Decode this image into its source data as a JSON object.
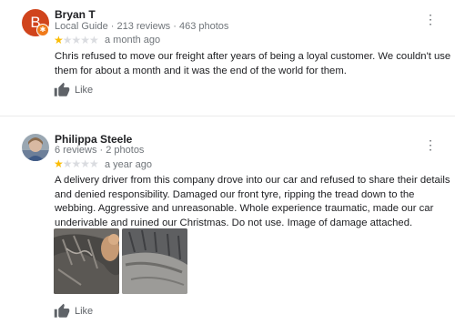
{
  "reviews": [
    {
      "avatar_letter": "B",
      "name": "Bryan T",
      "meta": "Local Guide · 213 reviews · 463 photos",
      "rating": 1,
      "time": "a month ago",
      "text": "Chris refused to move our freight after years of being a loyal customer. We couldn't use them for about a month and it was the end of the world for them.",
      "like_label": "Like",
      "more_icon": "more-vert-icon"
    },
    {
      "name": "Philippa Steele",
      "meta": "6 reviews · 2 photos",
      "rating": 1,
      "time": "a year ago",
      "text": "A delivery driver from this company drove into our car and refused to share their details and denied responsibility. Damaged our front tyre, ripping the tread down to the webbing. Aggressive and unreasonable. Whole experience traumatic, made our car underivable and ruined our Christmas. Do not use. Image of damage attached.",
      "like_label": "Like",
      "more_icon": "more-vert-icon",
      "photos": [
        "tyre-damage-photo",
        "tyre-tread-photo"
      ]
    }
  ],
  "colors": {
    "avatar_bg": "#d0441c",
    "local_guide_badge": "#f07a1a",
    "star_filled": "#fbbc04",
    "star_empty": "#dadce0",
    "meta_text": "#70757a"
  }
}
